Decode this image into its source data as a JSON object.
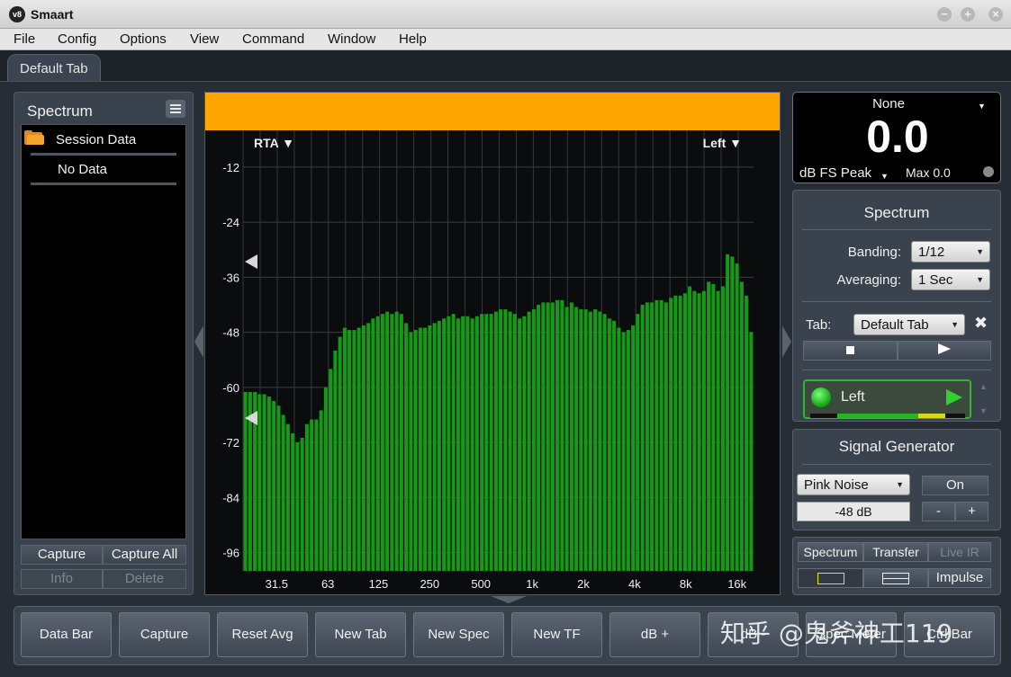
{
  "app": {
    "logo_text": "v8",
    "title": "Smaart"
  },
  "menu": [
    "File",
    "Config",
    "Options",
    "View",
    "Command",
    "Window",
    "Help"
  ],
  "tabs": [
    {
      "label": "Default Tab"
    }
  ],
  "data_panel": {
    "title": "Spectrum",
    "folder_label": "Session Data",
    "empty_label": "No Data",
    "buttons": {
      "capture": "Capture",
      "capture_all": "Capture All",
      "info": "Info",
      "delete": "Delete"
    }
  },
  "plot": {
    "mode_label": "RTA ▼",
    "channel_label": "Left ▼"
  },
  "meter": {
    "source": "None",
    "value": "0.0",
    "type": "dB FS Peak",
    "max": "Max 0.0"
  },
  "spectrum_settings": {
    "title": "Spectrum",
    "banding_label": "Banding:",
    "banding_value": "1/12",
    "averaging_label": "Averaging:",
    "averaging_value": "1 Sec",
    "tab_label": "Tab:",
    "tab_value": "Default Tab",
    "channel_name": "Left"
  },
  "signal_generator": {
    "title": "Signal Generator",
    "type": "Pink Noise",
    "on_label": "On",
    "level": "-48 dB",
    "minus": "-",
    "plus": "+"
  },
  "view_modes": {
    "spectrum": "Spectrum",
    "transfer": "Transfer",
    "live_ir": "Live IR",
    "impulse": "Impulse"
  },
  "toolbar": [
    "Data Bar",
    "Capture",
    "Reset Avg",
    "New Tab",
    "New Spec",
    "New TF",
    "dB +",
    "dB -",
    "Spec Meter",
    "Ctrl Bar"
  ],
  "watermark": "知乎 @鬼斧神工119",
  "colors": {
    "accent": "#ffa500",
    "bars": "#149a14",
    "active_channel": "#2fb52f"
  },
  "chart_data": {
    "type": "bar",
    "title": "",
    "xlabel": "",
    "ylabel": "",
    "x_scale": "log",
    "xlim": [
      20,
      20000
    ],
    "ylim": [
      -100,
      -4
    ],
    "y_ticks": [
      -12,
      -24,
      -36,
      -48,
      -60,
      -72,
      -84,
      -96
    ],
    "x_ticks": [
      "31.5",
      "63",
      "125",
      "250",
      "500",
      "1k",
      "2k",
      "4k",
      "8k",
      "16k"
    ],
    "x_tick_values": [
      31.5,
      63,
      125,
      250,
      500,
      1000,
      2000,
      4000,
      8000,
      16000
    ],
    "banding": "1/12 octave",
    "grid": true,
    "values": [
      -61,
      -61,
      -61,
      -61.5,
      -61.5,
      -62,
      -63,
      -64,
      -66,
      -68,
      -70,
      -72,
      -71,
      -68,
      -67,
      -67,
      -65,
      -60,
      -56,
      -52,
      -49,
      -47,
      -47.5,
      -47.5,
      -47,
      -46.5,
      -46,
      -45,
      -44.5,
      -44,
      -43.5,
      -44,
      -43.5,
      -44,
      -46,
      -48,
      -47.5,
      -47,
      -47,
      -46.5,
      -46,
      -45.5,
      -45,
      -44.5,
      -44,
      -45,
      -44.5,
      -44.5,
      -45,
      -44.5,
      -44,
      -44,
      -44,
      -43.5,
      -43,
      -43,
      -43.5,
      -44,
      -45,
      -44.5,
      -43.5,
      -43,
      -42,
      -41.5,
      -41.5,
      -41.5,
      -41,
      -41,
      -42.5,
      -41.5,
      -42.5,
      -43,
      -43,
      -43.5,
      -43,
      -43.5,
      -44,
      -45,
      -45.5,
      -47,
      -48,
      -47.5,
      -46.5,
      -44,
      -42,
      -41.5,
      -41.5,
      -41,
      -41,
      -41.5,
      -40.5,
      -40,
      -40,
      -39.5,
      -38,
      -39,
      -39.5,
      -39,
      -37,
      -37.5,
      -39,
      -38,
      -31,
      -31.5,
      -33,
      -37,
      -40,
      -48
    ]
  }
}
